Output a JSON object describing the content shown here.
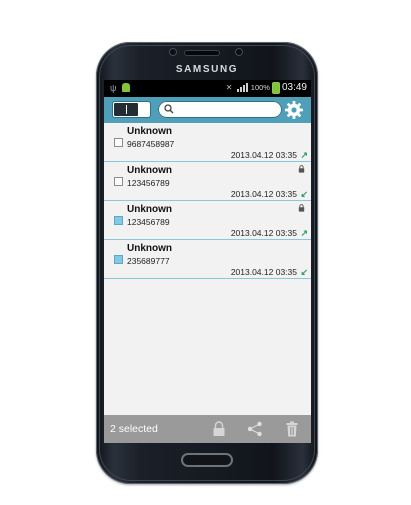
{
  "device": {
    "brand": "SAMSUNG"
  },
  "status_bar": {
    "battery": "100%",
    "time": "03:49"
  },
  "action_bar": {
    "search_placeholder": "",
    "icons": [
      "toggle-switch",
      "search-icon",
      "gear-icon"
    ]
  },
  "calls": [
    {
      "name": "Unknown",
      "number": "9687458987",
      "datetime": "2013.04.12 03:35",
      "direction": "outgoing",
      "locked": false,
      "selected": false
    },
    {
      "name": "Unknown",
      "number": "123456789",
      "datetime": "2013.04.12 03:35",
      "direction": "incoming",
      "locked": true,
      "selected": false
    },
    {
      "name": "Unknown",
      "number": "123456789",
      "datetime": "2013.04.12 03:35",
      "direction": "outgoing",
      "locked": true,
      "selected": true
    },
    {
      "name": "Unknown",
      "number": "235689777",
      "datetime": "2013.04.12 03:35",
      "direction": "incoming",
      "locked": false,
      "selected": true
    }
  ],
  "bottom_bar": {
    "selected_label": "2 selected",
    "icons": [
      "lock-icon",
      "share-icon",
      "trash-icon"
    ]
  },
  "colors": {
    "accent": "#4f9fb9",
    "arrow": "#2e9f62",
    "divider": "#8cc6d8",
    "selected_check": "#84c9e3",
    "bottom_bar": "#9a9a9a"
  }
}
